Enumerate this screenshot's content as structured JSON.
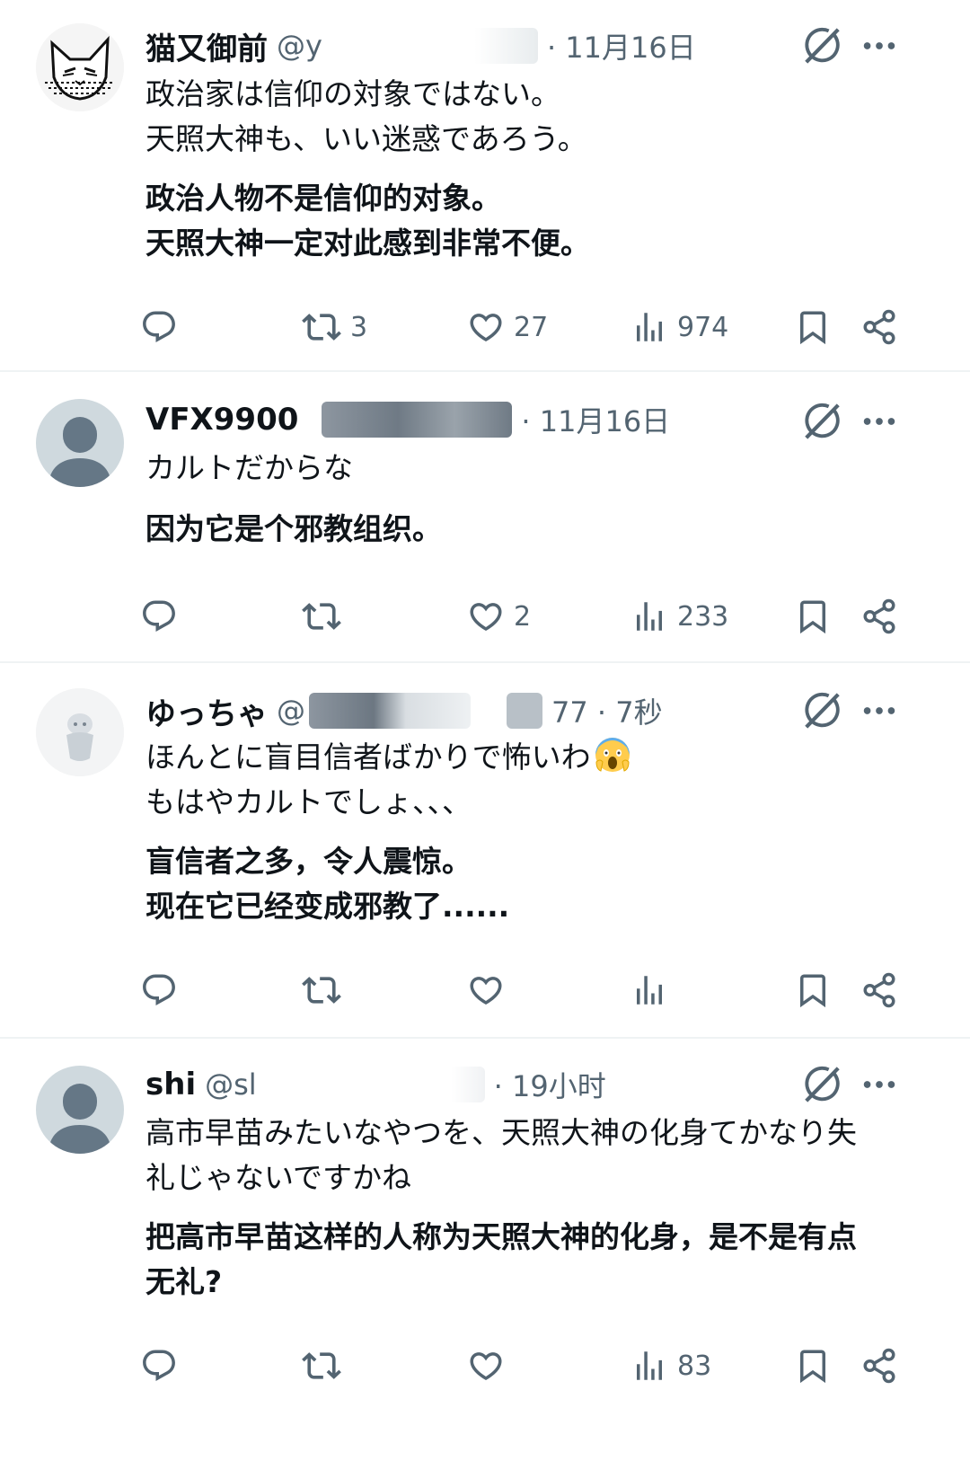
{
  "posts": [
    {
      "name": "猫又御前",
      "handle": "@y",
      "time": "· 11月16日",
      "jp": "政治家は信仰の対象ではない。\n天照大神も、いい迷惑であろう。",
      "zh": "政治人物不是信仰的对象。\n天照大神一定对此感到非常不便。",
      "reply_count": "",
      "repost_count": "3",
      "like_count": "27",
      "view_count": "974"
    },
    {
      "name": "VFX9900",
      "handle": "",
      "time": "· 11月16日",
      "jp": "カルトだからな",
      "zh": "因为它是个邪教组织。",
      "reply_count": "",
      "repost_count": "",
      "like_count": "2",
      "view_count": "233"
    },
    {
      "name": "ゆっちゃ",
      "handle": "@",
      "time": "77 · 7秒",
      "jp": "ほんとに盲目信者ばかりで怖いわ",
      "jp_line2": "もはやカルトでしょ、、、",
      "zh": "盲信者之多，令人震惊。\n现在它已经变成邪教了......",
      "reply_count": "",
      "repost_count": "",
      "like_count": "",
      "view_count": ""
    },
    {
      "name": "shi",
      "handle": "@sl",
      "time": "· 19小时",
      "jp": "高市早苗みたいなやつを、天照大神の化身てかなり失\n礼じゃないですかね",
      "zh": "把高市早苗这样的人称为天照大神的化身，是不是有点\n无礼?",
      "reply_count": "",
      "repost_count": "",
      "like_count": "",
      "view_count": "83"
    }
  ],
  "icons": {
    "reply": "reply-icon",
    "repost": "repost-icon",
    "like": "heart-icon",
    "views": "views-icon",
    "bookmark": "bookmark-icon",
    "share": "share-icon",
    "grok": "grok-icon",
    "more": "more-icon"
  },
  "colors": {
    "text": "#0f1419",
    "secondary": "#536471",
    "divider": "#eff3f4",
    "default_avatar": "#cfd9de"
  }
}
